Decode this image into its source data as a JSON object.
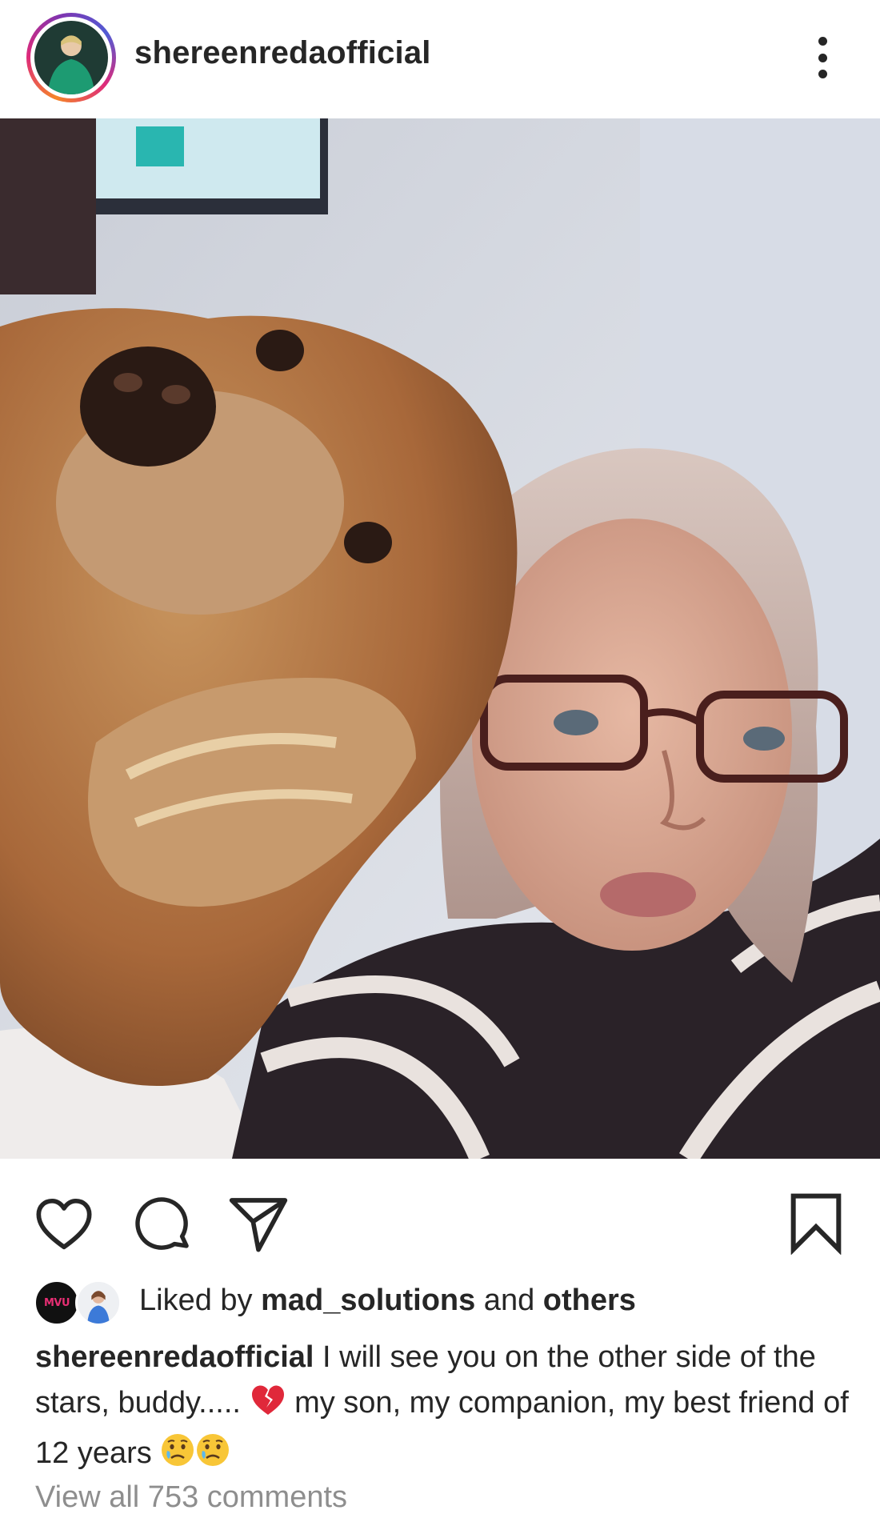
{
  "header": {
    "username": "shereenredaofficial",
    "more_icon": "more-vertical-icon"
  },
  "photo": {
    "alt_icon": "post-photo"
  },
  "actions": {
    "like_icon": "heart-icon",
    "comment_icon": "comment-icon",
    "share_icon": "paper-plane-icon",
    "save_icon": "bookmark-icon"
  },
  "likes": {
    "prefix": "Liked by ",
    "user": "mad_solutions",
    "middle": " and ",
    "others": "others",
    "avatar1_label": "MVU"
  },
  "caption": {
    "username": "shereenredaofficial",
    "text_part1": " I will see you on the other side of the stars, buddy..... ",
    "text_part2": " my son, my companion, my best friend of 12 years ",
    "emoji1": "broken-heart-icon",
    "emoji2": "crying-face-icon",
    "emoji3": "crying-face-icon"
  },
  "comments": {
    "view_all": "View all 753 comments"
  },
  "colors": {
    "text": "#262626",
    "muted": "#8e8e8e",
    "ring_start": "#f58529",
    "ring_end": "#dd2a7b"
  }
}
